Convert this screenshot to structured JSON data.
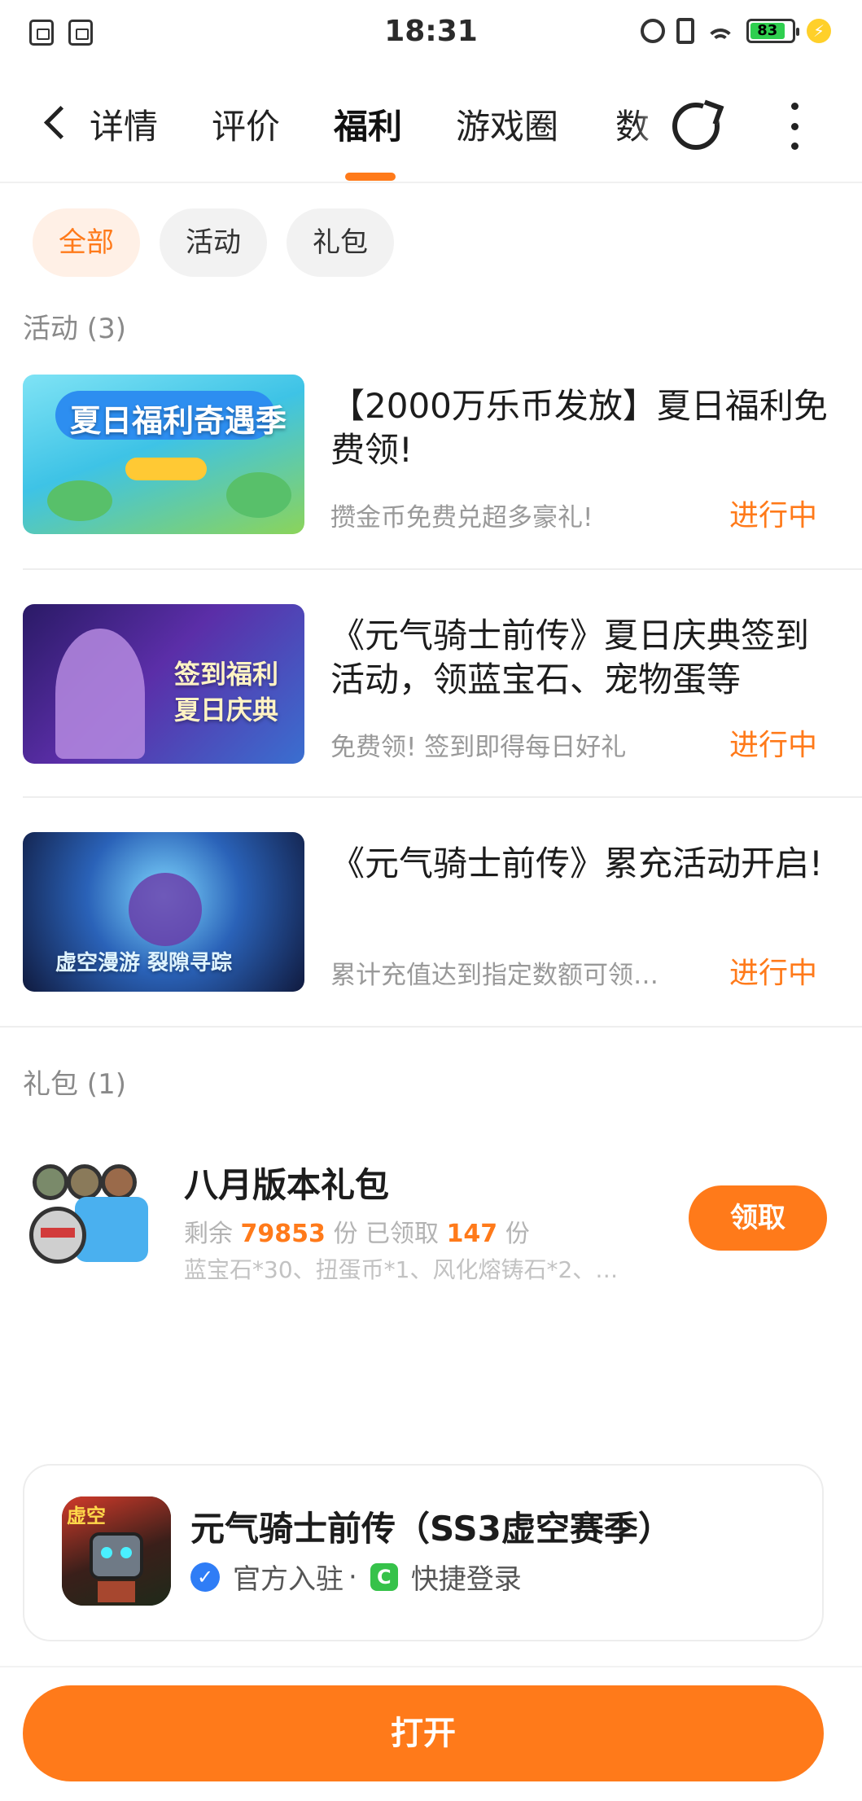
{
  "status_bar": {
    "time": "18:31",
    "battery": "83"
  },
  "nav": {
    "tabs": [
      {
        "label": "详情"
      },
      {
        "label": "评价"
      },
      {
        "label": "福利"
      },
      {
        "label": "游戏圈"
      },
      {
        "label": "数"
      }
    ],
    "active_tab": "福利"
  },
  "filters": [
    {
      "label": "全部"
    },
    {
      "label": "活动"
    },
    {
      "label": "礼包"
    }
  ],
  "activities": {
    "title": "活动 (3)",
    "items": [
      {
        "title": "【2000万乐币发放】夏日福利免费领!",
        "subtitle": "攒金币免费兑超多豪礼!",
        "status": "进行中",
        "thumb_text": "夏日福利奇遇季"
      },
      {
        "title": "《元气骑士前传》夏日庆典签到活动，领蓝宝石、宠物蛋等",
        "subtitle": "免费领! 签到即得每日好礼",
        "status": "进行中",
        "thumb_text": "签到福利 夏日庆典"
      },
      {
        "title": "《元气骑士前传》累充活动开启!",
        "subtitle": "累计充值达到指定数额可领…",
        "status": "进行中",
        "thumb_text": "虚空漫游 裂隙寻踪"
      }
    ]
  },
  "gifts": {
    "title": "礼包 (1)",
    "items": [
      {
        "title": "八月版本礼包",
        "remaining_label": "剩余",
        "remaining": "79853",
        "unit": "份",
        "claimed_label": "已领取",
        "claimed": "147",
        "description": "蓝宝石*30、扭蛋币*1、风化熔铸石*2、…",
        "button": "领取"
      }
    ]
  },
  "app": {
    "name": "元气骑士前传（SS3虚空赛季）",
    "icon_label": "虚空",
    "official": "官方入驻",
    "separator": "·",
    "quick_login": "快捷登录"
  },
  "open_button": "打开",
  "colors": {
    "accent": "#ff7a1a",
    "chip_active_bg": "#fff0e6"
  }
}
